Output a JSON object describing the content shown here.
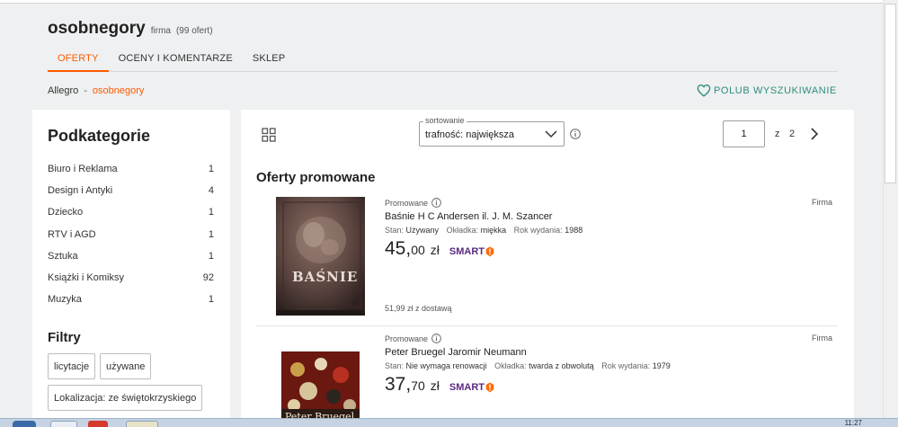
{
  "seller": {
    "name": "osobnegory",
    "type": "firma",
    "offer_count": "(99 ofert)"
  },
  "tabs": [
    {
      "label": "OFERTY",
      "active": true
    },
    {
      "label": "OCENY I KOMENTARZE",
      "active": false
    },
    {
      "label": "SKLEP",
      "active": false
    }
  ],
  "breadcrumb": {
    "root": "Allegro",
    "separator": "-",
    "current": "osobnegory"
  },
  "like_search": {
    "label": "POLUB WYSZUKIWANIE",
    "icon": "heart-outline-icon"
  },
  "sidebar": {
    "title": "Podkategorie",
    "categories": [
      {
        "label": "Biuro i Reklama",
        "count": "1"
      },
      {
        "label": "Design i Antyki",
        "count": "4"
      },
      {
        "label": "Dziecko",
        "count": "1"
      },
      {
        "label": "RTV i AGD",
        "count": "1"
      },
      {
        "label": "Sztuka",
        "count": "1"
      },
      {
        "label": "Książki i Komiksy",
        "count": "92"
      },
      {
        "label": "Muzyka",
        "count": "1"
      }
    ],
    "filters_title": "Filtry",
    "filters": [
      "licytacje",
      "używane",
      "Lokalizacja: ze świętokrzyskiego"
    ]
  },
  "toolbar": {
    "sort_legend": "sortowanie",
    "sort_value": "trafność: największa",
    "page_current": "1",
    "page_of": "z",
    "page_total": "2"
  },
  "section_title": "Oferty promowane",
  "offers": [
    {
      "promo": "Promowane",
      "seller_tag": "Firma",
      "title": "Baśnie H C Andersen il. J. M. Szancer",
      "params": [
        {
          "key": "Stan:",
          "value": "Używany"
        },
        {
          "key": "Okładka:",
          "value": "miękka"
        },
        {
          "key": "Rok wydania:",
          "value": "1988"
        }
      ],
      "price_int": "45,",
      "price_dec": "00",
      "currency": "zł",
      "smart": "SMART",
      "delivery": "51,99 zł z dostawą",
      "cover_text": "BAŚNIE"
    },
    {
      "promo": "Promowane",
      "seller_tag": "Firma",
      "title": "Peter Bruegel Jaromir Neumann",
      "params": [
        {
          "key": "Stan:",
          "value": "Nie wymaga renowacji"
        },
        {
          "key": "Okładka:",
          "value": "twarda z obwolutą"
        },
        {
          "key": "Rok wydania:",
          "value": "1979"
        }
      ],
      "price_int": "37,",
      "price_dec": "70",
      "currency": "zł",
      "smart": "SMART",
      "cover_text": "Peter Bruegel"
    }
  ],
  "taskbar": {
    "clock": "11:27"
  },
  "colors": {
    "accent": "#ff5a00",
    "like": "#2f8c7e",
    "smart": "#5a2a82",
    "smart_badge": "#ff6a00"
  }
}
